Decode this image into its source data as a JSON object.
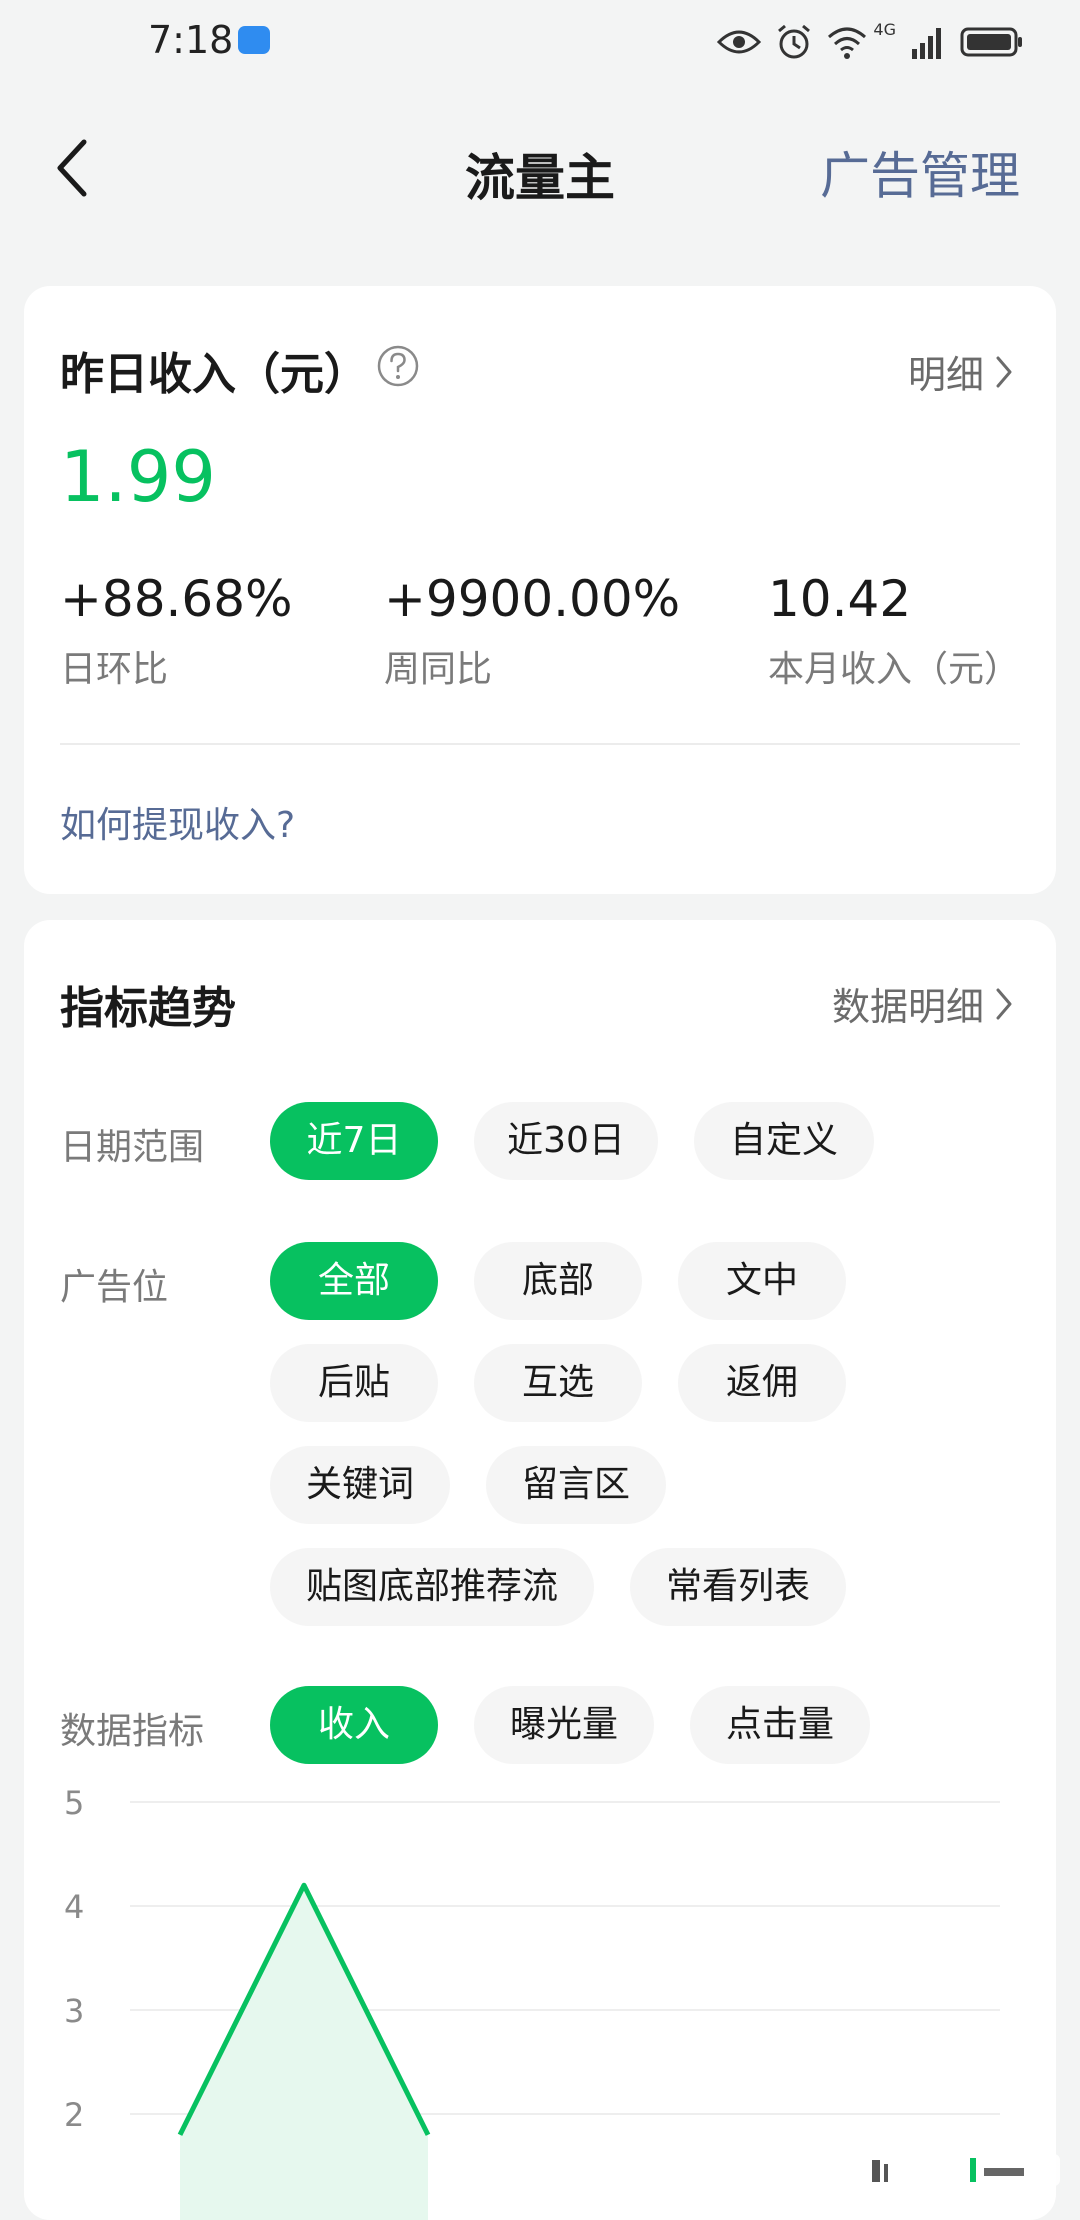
{
  "status_bar": {
    "time": "7:18",
    "network": "4G"
  },
  "nav": {
    "title": "流量主",
    "right_link": "广告管理"
  },
  "income": {
    "title": "昨日收入（元）",
    "detail_label": "明细",
    "value": "1.99",
    "stats": [
      {
        "value": "+88.68%",
        "label": "日环比"
      },
      {
        "value": "+9900.00%",
        "label": "周同比"
      },
      {
        "value": "10.42",
        "label": "本月收入（元）"
      }
    ],
    "how_to_withdraw": "如何提现收入?"
  },
  "trend": {
    "title": "指标趋势",
    "detail_label": "数据明细",
    "date_range": {
      "label": "日期范围",
      "options": [
        "近7日",
        "近30日",
        "自定义"
      ],
      "selected": "近7日"
    },
    "ad_position": {
      "label": "广告位",
      "options": [
        "全部",
        "底部",
        "文中",
        "后贴",
        "互选",
        "返佣",
        "关键词",
        "留言区",
        "贴图底部推荐流",
        "常看列表"
      ],
      "selected": "全部"
    },
    "metric": {
      "label": "数据指标",
      "options": [
        "收入",
        "曝光量",
        "点击量"
      ],
      "selected": "收入"
    }
  },
  "chart_data": {
    "type": "area",
    "y_ticks": [
      "5",
      "4",
      "3",
      "2"
    ],
    "ylim": [
      2,
      5
    ],
    "visible_points": [
      {
        "x": 0,
        "y": 1.8
      },
      {
        "x": 1,
        "y": 4.2
      },
      {
        "x": 2,
        "y": 1.8
      }
    ],
    "line_color": "#07c160",
    "fill_color": "#e6f8ee",
    "grid": true
  },
  "colors": {
    "accent": "#07c160",
    "link": "#576b95",
    "muted": "#7a7a7a"
  }
}
